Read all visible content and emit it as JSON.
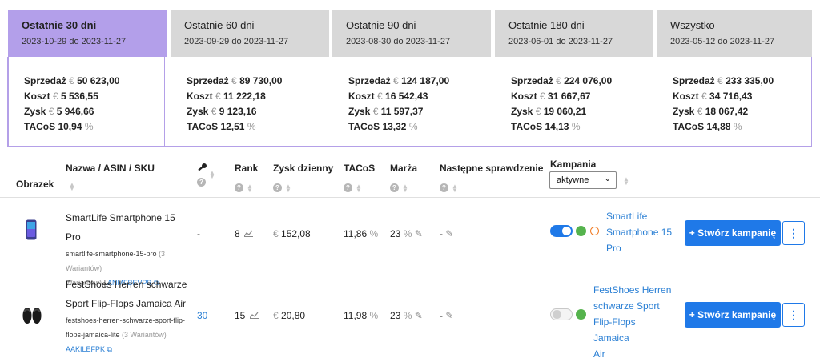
{
  "tabs": [
    {
      "title": "Ostatnie 30 dni",
      "range": "2023-10-29 do 2023-11-27",
      "sales_label": "Sprzedaż",
      "sales": "50 623,00",
      "cost_label": "Koszt",
      "cost": "5 536,55",
      "profit_label": "Zysk",
      "profit": "5 946,66",
      "tacos_label": "TACoS",
      "tacos": "10,94",
      "active": true
    },
    {
      "title": "Ostatnie 60 dni",
      "range": "2023-09-29 do 2023-11-27",
      "sales_label": "Sprzedaż",
      "sales": "89 730,00",
      "cost_label": "Koszt",
      "cost": "11 222,18",
      "profit_label": "Zysk",
      "profit": "9 123,16",
      "tacos_label": "TACoS",
      "tacos": "12,51",
      "active": false
    },
    {
      "title": "Ostatnie 90 dni",
      "range": "2023-08-30 do 2023-11-27",
      "sales_label": "Sprzedaż",
      "sales": "124 187,00",
      "cost_label": "Koszt",
      "cost": "16 542,43",
      "profit_label": "Zysk",
      "profit": "11 597,37",
      "tacos_label": "TACoS",
      "tacos": "13,32",
      "active": false
    },
    {
      "title": "Ostatnie 180 dni",
      "range": "2023-06-01 do 2023-11-27",
      "sales_label": "Sprzedaż",
      "sales": "224 076,00",
      "cost_label": "Koszt",
      "cost": "31 667,67",
      "profit_label": "Zysk",
      "profit": "19 060,21",
      "tacos_label": "TACoS",
      "tacos": "14,13",
      "active": false
    },
    {
      "title": "Wszystko",
      "range": "2023-05-12 do 2023-11-27",
      "sales_label": "Sprzedaż",
      "sales": "233 335,00",
      "cost_label": "Koszt",
      "cost": "34 716,43",
      "profit_label": "Zysk",
      "profit": "18 067,42",
      "tacos_label": "TACoS",
      "tacos": "14,88",
      "active": false
    }
  ],
  "currency": "€",
  "percent": "%",
  "columns": {
    "image": "Obrazek",
    "name": "Nazwa / ASIN / SKU",
    "rank": "Rank",
    "daily_profit": "Zysk dzienny",
    "tacos": "TACoS",
    "margin": "Marża",
    "next_check": "Następne sprawdzenie",
    "campaign": "Kampania",
    "campaign_filter": "aktywne"
  },
  "rows": [
    {
      "name": "SmartLife Smartphone 15 Pro",
      "sku": "smartlife-smartphone-15-pro",
      "variants": "(3 Wariantów)",
      "asin": "ANMFBEVPB",
      "key": "-",
      "rank": "8",
      "daily_profit": "152,08",
      "tacos": "11,86",
      "margin": "23",
      "next_check": "-",
      "campaign_active": true,
      "campaign_name_lines": [
        "SmartLife",
        "Smartphone 15",
        "Pro"
      ],
      "create_btn": "Stwórz kampanię",
      "image": "phone-icon"
    },
    {
      "name_lines": [
        "FestShoes Herren schwarze",
        "Sport Flip-Flops Jamaica Air"
      ],
      "sku_lines": [
        "festshoes-herren-schwarze-sport-flip-",
        "flops-jamaica-lite"
      ],
      "variants": "(3 Wariantów)",
      "asin": "AAKILEFPK",
      "key": "30",
      "rank": "15",
      "daily_profit": "20,80",
      "tacos": "11,98",
      "margin": "23",
      "next_check": "-",
      "campaign_active": false,
      "campaign_name_lines": [
        "FestShoes Herren",
        "schwarze Sport",
        "Flip-Flops Jamaica",
        "Air"
      ],
      "create_btn": "Stwórz kampanię",
      "image": "flip-flops-icon"
    }
  ],
  "colors": {
    "active_tab": "#b39fea",
    "inactive_tab": "#d8d8d8",
    "accent_blue": "#1f79e8",
    "status_green": "#55b34d",
    "clock_orange": "#f07a22"
  }
}
